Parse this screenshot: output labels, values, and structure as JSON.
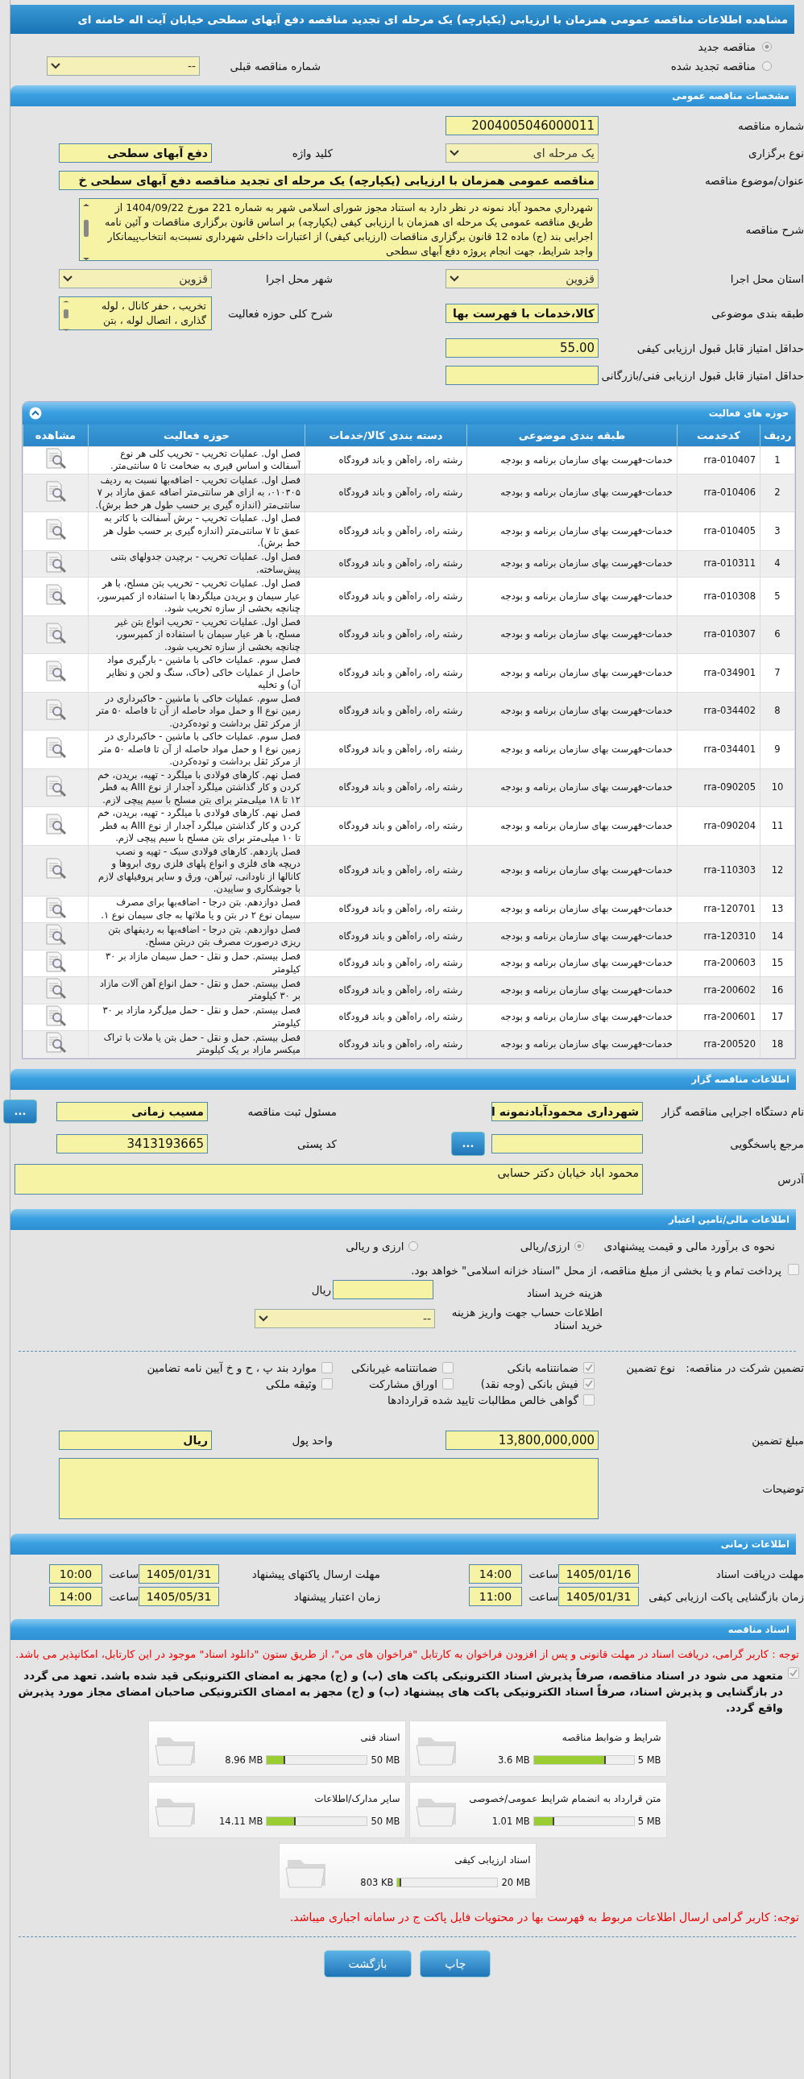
{
  "page_title": "مشاهده اطلاعات مناقصه عمومی همزمان با ارزیابی (یکپارچه) یک مرحله ای تجدید مناقصه دفع آبهای سطحی خیابان آیت اله خامنه ای",
  "tender_kind": [
    {
      "label": "مناقصه جدید",
      "selected": true
    },
    {
      "label": "مناقصه تجدید شده",
      "selected": false
    }
  ],
  "previous_tender": {
    "label": "شماره مناقصه قبلی",
    "value": "--"
  },
  "general": {
    "title": "مشخصات مناقصه عمومی",
    "tender_number": {
      "label": "شماره مناقصه",
      "value": "2004005046000011"
    },
    "holding_type": {
      "label": "نوع برگزاری",
      "value": "یک مرحله ای"
    },
    "keyword": {
      "label": "کلید واژه",
      "value": "دفع آبهای سطحی"
    },
    "subject": {
      "label": "عنوان/موضوع مناقصه",
      "value": "مناقصه عمومی همزمان با ارزیابی (یکپارچه) یک مرحله ای تجدید مناقصه دفع آبهای سطحی خ"
    },
    "description": {
      "label": "شرح مناقصه",
      "value": "شهرداري محمود آباد نمونه در نظر دارد به استناد مجوز شورای اسلامی شهر به شماره  221 مورخ 1404/09/22  از طریق مناقصه عمومی یک مرحله ای همزمان با ارزیابی کیفی (یکپارچه) بر اساس قانون برگزاری  مناقصات و آئین نامه اجرایی بند (ج) ماده 12 قانون برگزاری مناقصات (ارزیابی کیفی) از اعتبارات داخلی شهرداری نسبت‌به انتخاب‌پیمانکار واجد شرایط، جهت انجام پروژه  دفع آبهای سطحی"
    },
    "province": {
      "label": "استان محل اجرا",
      "value": "قزوین"
    },
    "city": {
      "label": "شهر محل اجرا",
      "value": "قزوین"
    },
    "subject_category": {
      "label": "طبقه بندی موضوعی",
      "value": "کالا،خدمات با فهرست بها"
    },
    "activity_scope": {
      "label": "شرح کلی حوزه فعالیت",
      "value": "تخریب ، حفر کانال ، لوله گذاری ، اتصال لوله ، بتن"
    },
    "min_quality_score": {
      "label": "حداقل امتیاز قابل قبول ارزیابی کیفی",
      "value": "55.00"
    },
    "min_technical_score": {
      "label": "حداقل امتیاز قابل قبول ارزیابی فنی/بازرگانی"
    }
  },
  "activities": {
    "title": "حوزه های فعالیت",
    "columns": [
      "ردیف",
      "کدخدمت",
      "طبقه بندی موضوعی",
      "دسته بندی کالا/خدمات",
      "حوزه فعالیت",
      "مشاهده"
    ],
    "rows": [
      {
        "row": "1",
        "code": "rra-010407",
        "category": "خدمات-فهرست بهای سازمان برنامه و بودجه",
        "goods_category": "رشته راه، راه‌آهن و باند فرودگاه",
        "activity": "فصل اول. عملیات تخریب - تخریب کلی هر نوع آسفالت و اساس قیری به ضخامت تا ۵ سانتی‌متر."
      },
      {
        "row": "2",
        "code": "rra-010406",
        "category": "خدمات-فهرست بهای سازمان برنامه و بودجه",
        "goods_category": "رشته راه، راه‌آهن و باند فرودگاه",
        "activity": "فصل اول. عملیات تخریب - اضافه‌بها نسبت به ردیف ۰۱۰۴۰۵، به ازای هر سانتی‌متر اضافه عمق مازاد بر ۷ سانتی‌متر (اندازه گیری بر حسب طول هر خط برش)."
      },
      {
        "row": "3",
        "code": "rra-010405",
        "category": "خدمات-فهرست بهای سازمان برنامه و بودجه",
        "goods_category": "رشته راه، راه‌آهن و باند فرودگاه",
        "activity": "فصل اول. عملیات تخریب - برش آسفالت با کاتر به عمق تا ۷ سانتی‌متر (اندازه گیری بر حسب طول هر خط برش)."
      },
      {
        "row": "4",
        "code": "rra-010311",
        "category": "خدمات-فهرست بهای سازمان برنامه و بودجه",
        "goods_category": "رشته راه، راه‌آهن و باند فرودگاه",
        "activity": "فصل اول. عملیات تخریب - برچیدن جدولهای بتنی پیش‌ساخته."
      },
      {
        "row": "5",
        "code": "rra-010308",
        "category": "خدمات-فهرست بهای سازمان برنامه و بودجه",
        "goods_category": "رشته راه، راه‌آهن و باند فرودگاه",
        "activity": "فصل اول. عملیات تخریب - تخریب بتن مسلح، با هر عیار سیمان و بریدن میلگردها با استفاده از کمپرسور، چنانچه بخشی از سازه تخریب شود."
      },
      {
        "row": "6",
        "code": "rra-010307",
        "category": "خدمات-فهرست بهای سازمان برنامه و بودجه",
        "goods_category": "رشته راه، راه‌آهن و باند فرودگاه",
        "activity": "فصل اول. عملیات تخریب - تخریب انواع بتن غیر مسلح، با هر عیار سیمان با استفاده از کمپرسور، چنانچه بخشی از سازه تخریب شود."
      },
      {
        "row": "7",
        "code": "rra-034901",
        "category": "خدمات-فهرست بهای سازمان برنامه و بودجه",
        "goods_category": "رشته راه، راه‌آهن و باند فرودگاه",
        "activity": "فصل سوم. عملیات خاکی با ماشین - بارگیری مواد حاصل از عملیات خاکی (خاک، سنگ و لجن و نظایر آن) و تخلیه"
      },
      {
        "row": "8",
        "code": "rra-034402",
        "category": "خدمات-فهرست بهای سازمان برنامه و بودجه",
        "goods_category": "رشته راه، راه‌آهن و باند فرودگاه",
        "activity": "فصل سوم. عملیات خاکی با ماشین - خاکبرداری در زمین نوع II و حمل مواد حاصله از آن تا فاصله ۵۰ متر از مرکز ثقل برداشت و توده‌کردن."
      },
      {
        "row": "9",
        "code": "rra-034401",
        "category": "خدمات-فهرست بهای سازمان برنامه و بودجه",
        "goods_category": "رشته راه، راه‌آهن و باند فرودگاه",
        "activity": "فصل سوم. عملیات خاکی با ماشین - خاکبرداری در زمین نوع I و حمل مواد حاصله از آن تا فاصله ۵۰ متر از مرکز ثقل برداشت و توده‌کردن."
      },
      {
        "row": "10",
        "code": "rra-090205",
        "category": "خدمات-فهرست بهای سازمان برنامه و بودجه",
        "goods_category": "رشته راه، راه‌آهن و باند فرودگاه",
        "activity": "فصل نهم. کارهای فولادی با میلگرد - تهیه، بریدن، خم کردن و کار گذاشتن میلگرد آجدار از نوع AIII به قطر ۱۲ تا ۱۸ میلی‌متر برای بتن مسلح با سیم پیچی لازم."
      },
      {
        "row": "11",
        "code": "rra-090204",
        "category": "خدمات-فهرست بهای سازمان برنامه و بودجه",
        "goods_category": "رشته راه، راه‌آهن و باند فرودگاه",
        "activity": "فصل نهم. کارهای فولادی با میلگرد - تهیه، بریدن، خم کردن و کار گذاشتن میلگرد آجدار از نوع AIII به قطر تا ۱۰ میلی‌متر برای بتن مسلح با سیم پیچی لازم."
      },
      {
        "row": "12",
        "code": "rra-110303",
        "category": "خدمات-فهرست بهای سازمان برنامه و بودجه",
        "goods_category": "رشته راه، راه‌آهن و باند فرودگاه",
        "activity": "فصل یازدهم. کارهای فولادی سبک - تهیه و نصب دریچه های فلزی و انواع پلهای فلزی روی ابروها و کانالها از ناودانی، تیرآهن، ورق و سایر پروفیلهای لازم با جوشکاری و ساییدن."
      },
      {
        "row": "13",
        "code": "rra-120701",
        "category": "خدمات-فهرست بهای سازمان برنامه و بودجه",
        "goods_category": "رشته راه، راه‌آهن و باند فرودگاه",
        "activity": "فصل دوازدهم. بتن درجا - اضافه‌بها برای مصرف سیمان نوع ۲ در بتن و یا ملاتها به جای سیمان نوع ۱."
      },
      {
        "row": "14",
        "code": "rra-120310",
        "category": "خدمات-فهرست بهای سازمان برنامه و بودجه",
        "goods_category": "رشته راه، راه‌آهن و باند فرودگاه",
        "activity": "فصل دوازدهم. بتن درجا - اضافه‌بها به ردیفهای بتن ریزی درصورت مصرف بتن دربتن مسلح."
      },
      {
        "row": "15",
        "code": "rra-200603",
        "category": "خدمات-فهرست بهای سازمان برنامه و بودجه",
        "goods_category": "رشته راه، راه‌آهن و باند فرودگاه",
        "activity": "فصل بیستم. حمل و نقل - حمل سیمان مازاد بر ۳۰ کیلومتر"
      },
      {
        "row": "16",
        "code": "rra-200602",
        "category": "خدمات-فهرست بهای سازمان برنامه و بودجه",
        "goods_category": "رشته راه، راه‌آهن و باند فرودگاه",
        "activity": "فصل بیستم. حمل و نقل -  حمل انواع آهن آلات مازاد بر ۳۰ کیلومتر"
      },
      {
        "row": "17",
        "code": "rra-200601",
        "category": "خدمات-فهرست بهای سازمان برنامه و بودجه",
        "goods_category": "رشته راه، راه‌آهن و باند فرودگاه",
        "activity": "فصل بیستم. حمل و نقل -  حمل میل‌گرد مازاد بر ۳۰ کیلومتر"
      },
      {
        "row": "18",
        "code": "rra-200520",
        "category": "خدمات-فهرست بهای سازمان برنامه و بودجه",
        "goods_category": "رشته راه، راه‌آهن و باند فرودگاه",
        "activity": "فصل بیستم. حمل و نقل - حمل بتن یا ملات با تراک میکسر مازاد بر یک کیلومتر"
      }
    ]
  },
  "organizer": {
    "title": "اطلاعات مناقصه گزار",
    "org_name": {
      "label": "نام دستگاه اجرایی مناقصه گزار",
      "value": "شهرداری محمودآبادنمونه ا"
    },
    "registrar": {
      "label": "مسئول ثبت مناقصه",
      "value": "مسیب زمانی",
      "button": "..."
    },
    "response_ref": {
      "label": "مرجع پاسخگویی",
      "button": "..."
    },
    "postal_code": {
      "label": "کد پستی",
      "value": "3413193665"
    },
    "address": {
      "label": "آدرس",
      "value": "محمود اباد خیابان دکتر حسابی"
    }
  },
  "financial": {
    "title": "اطلاعات مالی/تامین اعتبار",
    "estimate": {
      "label": "نحوه ی برآورد مالی و قیمت پیشنهادی",
      "options": [
        {
          "label": "ارزی/ریالی",
          "selected": true
        },
        {
          "label": "ارزی و ریالی",
          "selected": false
        }
      ]
    },
    "treasury": {
      "label": "پرداخت تمام و یا بخشی از مبلغ مناقصه، از محل \"اسناد خزانه اسلامی\" خواهد بود.",
      "checked": false
    },
    "doc_fee": {
      "label": "هزینه خرید اسناد",
      "unit": "ریال"
    },
    "account": {
      "label": "اطلاعات حساب جهت واریز هزینه خرید اسناد",
      "value": "--"
    }
  },
  "guarantee": {
    "title": "تضمین شرکت در مناقصه:",
    "type_label": "نوع تضمین",
    "options": [
      {
        "label": "ضمانتنامه بانکی",
        "checked": true
      },
      {
        "label": "ضمانتنامه غیربانکی",
        "checked": false
      },
      {
        "label": "موارد بند پ ، ح و خ آیین نامه تضامین",
        "checked": false
      },
      {
        "label": "فیش بانکی (وجه نقد)",
        "checked": true
      },
      {
        "label": "اوراق مشارکت",
        "checked": false
      },
      {
        "label": "وثیقه ملکی",
        "checked": false
      },
      {
        "label": "گواهی خالص مطالبات تایید شده قراردادها",
        "checked": false
      }
    ],
    "amount": {
      "label": "مبلغ تضمین",
      "value": "13,800,000,000"
    },
    "currency": {
      "label": "واحد پول",
      "value": "ریال"
    },
    "notes": {
      "label": "توضیحات"
    }
  },
  "timing": {
    "title": "اطلاعات زمانی",
    "items": [
      {
        "label": "مهلت دریافت اسناد",
        "date": "1405/01/16",
        "time_label": "ساعت",
        "time": "14:00"
      },
      {
        "label": "مهلت ارسال پاکتهای پیشنهاد",
        "date": "1405/01/31",
        "time_label": "ساعت",
        "time": "10:00"
      },
      {
        "label": "زمان بازگشایی پاکت ارزیابی کیفی",
        "date": "1405/01/31",
        "time_label": "ساعت",
        "time": "11:00"
      },
      {
        "label": "زمان اعتبار پیشنهاد",
        "date": "1405/05/31",
        "time_label": "ساعت",
        "time": "14:00"
      }
    ]
  },
  "documents": {
    "title": "اسناد مناقصه",
    "notice": "توجه : کاربر گرامی، دریافت اسناد در مهلت قانونی و پس از افزودن فراخوان به کارتابل \"فراخوان های من\"، از طریق ستون \"دانلود اسناد\" موجود در این کارتابل، امکانپذیر می باشد.",
    "commitment": {
      "text": "متعهد می شود در اسناد مناقصه، صرفاً پذیرش اسناد الکترونیکی پاکت های (ب) و (ج) مجهز به امضای الکترونیکی قید شده باشد. تعهد می گردد در بازگشایی و پذیرش اسناد، صرفاً اسناد الکترونیکی پاکت های پیشنهاد (ب) و (ج) مجهز به امضای الکترونیکی صاحبان امضای مجاز مورد پذیرش واقع گردد.",
      "checked": true
    },
    "files": [
      {
        "title": "شرایط و ضوابط مناقصه",
        "size": "3.6 MB",
        "max": "5 MB",
        "level": 0.72
      },
      {
        "title": "اسناد فنی",
        "size": "8.96 MB",
        "max": "50 MB",
        "level": 0.18
      },
      {
        "title": "متن قرارداد به انضمام شرایط عمومی/خصوصی",
        "size": "1.01 MB",
        "max": "5 MB",
        "level": 0.2
      },
      {
        "title": "سایر مدارک/اطلاعات",
        "size": "14.11 MB",
        "max": "50 MB",
        "level": 0.29
      },
      {
        "title": "اسناد ارزیابی کیفی",
        "size": "803 KB",
        "max": "20 MB",
        "level": 0.04
      }
    ],
    "footer_note": "توجه: کاربر گرامی ارسال اطلاعات مربوط به فهرست بها در محتویات فایل پاکت ج در سامانه اجباری میباشد."
  },
  "buttons": [
    "چاپ",
    "بازگشت"
  ]
}
